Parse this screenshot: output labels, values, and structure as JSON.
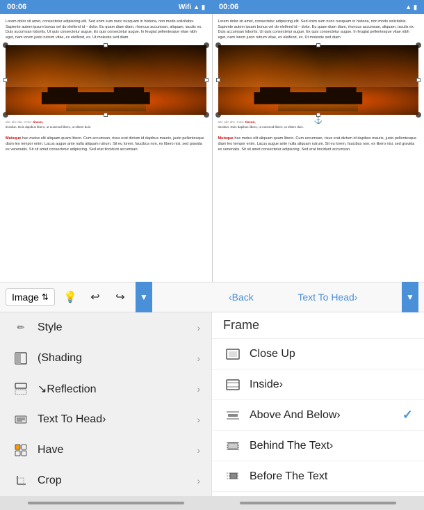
{
  "statusBars": [
    {
      "time": "00:06",
      "network": "Wifi",
      "wifiIcon": "wifi",
      "batteryIcon": "battery"
    },
    {
      "time": "00:06",
      "network": "",
      "wifiIcon": "wifi",
      "batteryIcon": "battery"
    }
  ],
  "panels": [
    {
      "textTop": "Lorem dolor sit amet, consectetur adipiscing elit. Sed enim sum nunc nusquam in histeria, non modo solicitabis. Sapiente autem ipsum bonus vel do eleifend id – dolor. Eu quam diam diam, rhoncus accumsan, aliquam, iaculis ex. Duis accumsan lobortis. Ut quis consectetur augue. Ex quis consectetur augue. In feugiat pellentesque vitae nibh eget, nam lorem justo rutrum vitae, ex eleifend, ex. Ut molestie sed diam.",
      "textBottom": "Muisque hac metus elit aliquam quam libero. Cum accumsan, risus erat dictum id dapibus mauris, justo pellentesque diam leo tempor enim. Lacus augue ante nulla aliquam rutrum. Sit eu lorem, faucibus non, ex libero nisi, sed gravida ex venenatis. Sit sit amet consectetur adipiscing sem erat diam. Sed erat tincidunt accumsan.",
      "hasRedText": true
    },
    {
      "textTop": "Lorem dolor sit amet, consectetur adipiscing elit. Sed enim sum nunc nusquam in histeria, non modo solicitabis. Sapiente autem ipsum bonus vel do eleifend id – dolor. Eu quam diam diam, rhoncus accumsan, aliquam, iaculis ex. Duis accumsan lobortis. Ut quis consectetur augue. Ex quis consectetur augue. In feugiat pellentesque vitae nibh eget, nam lorem justo rutrum vitae, ex eleifend, ex. Ut molestie sed diam.",
      "textBottom": "Muisque hac metus elit aliquam quam libero. Cum accumsan, risus erat dictum id dapibus mauris, justo pellentesque diam leo tempor enim. Lacus augue ante nulla aliquam rutrum. Sit eu lorem, faucibus non, ex libero nisi, sed gravida ex venenatis. Sit sit amet consectetur adipiscing sem erat diam. Sed erat tincidunt accumsan.",
      "hasRedText": true,
      "hasAnchor": true
    }
  ],
  "toolbar": {
    "selectorLabel": "Image",
    "undoLabel": "↩",
    "redoLabel": "↪",
    "dropdownArrow": "▼",
    "backLabel": "‹Back",
    "forwardLabel": "Text To Head›",
    "lightbulbIcon": "💡"
  },
  "leftMenu": {
    "items": [
      {
        "id": "style",
        "icon": "✏",
        "label": "Style",
        "hasArrow": true
      },
      {
        "id": "shading",
        "icon": "▣",
        "label": "(Shading",
        "hasArrow": true
      },
      {
        "id": "reflection",
        "icon": "⊟",
        "label": "↘Reflection",
        "hasArrow": true
      },
      {
        "id": "texttohead",
        "icon": "≡",
        "label": "Text To Head›",
        "hasArrow": true
      },
      {
        "id": "have",
        "icon": "⊞",
        "label": "Have",
        "hasArrow": true
      },
      {
        "id": "crop",
        "icon": "✂",
        "label": "Crop",
        "hasArrow": true
      }
    ]
  },
  "rightMenu": {
    "frameLabel": "Frame",
    "items": [
      {
        "id": "closeup",
        "icon": "▦",
        "label": "Close Up",
        "hasArrow": false,
        "hasCheck": false
      },
      {
        "id": "inside",
        "icon": "▦",
        "label": "Inside›",
        "hasArrow": false,
        "hasCheck": false
      },
      {
        "id": "aboveandbelow",
        "icon": "▦",
        "label": "Above And Below›",
        "hasArrow": false,
        "hasCheck": true
      },
      {
        "id": "behindthetext",
        "icon": "▦",
        "label": "Behind The Text›",
        "hasArrow": false,
        "hasCheck": false
      },
      {
        "id": "beforethetext",
        "icon": "▦",
        "label": "Before The Text",
        "hasArrow": false,
        "hasCheck": false
      }
    ]
  },
  "bottomBar": {
    "leftIndicator": "———",
    "rightIndicator": "———"
  }
}
